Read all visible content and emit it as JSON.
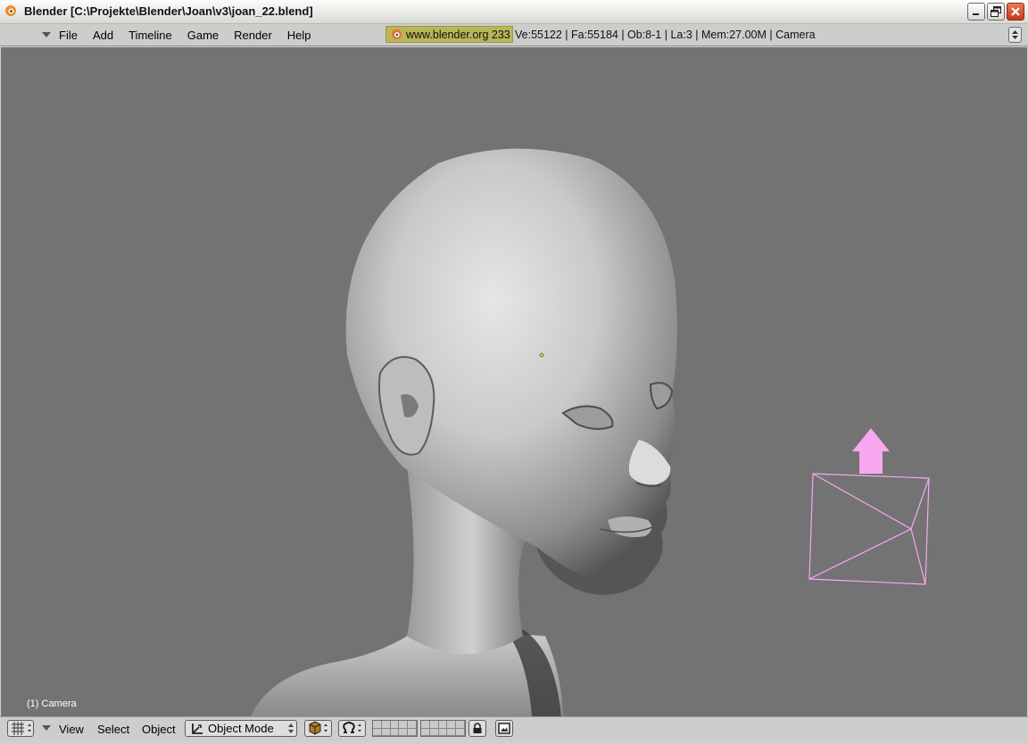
{
  "window": {
    "title": "Blender [C:\\Projekte\\Blender\\Joan\\v3\\joan_22.blend]"
  },
  "menubar": {
    "items": [
      "File",
      "Add",
      "Timeline",
      "Game",
      "Render",
      "Help"
    ]
  },
  "info": {
    "badge": "www.blender.org 233",
    "stats": "Ve:55122 | Fa:55184 | Ob:8-1 | La:3 | Mem:27.00M | Camera"
  },
  "viewport": {
    "object_label": "(1) Camera",
    "background_color": "#737373",
    "camera_wire_color": "#f7a8f0"
  },
  "bottom_header": {
    "menus": [
      "View",
      "Select",
      "Object"
    ],
    "mode": "Object Mode"
  },
  "icons": {
    "app": "blender-logo-icon",
    "minimize": "minimize-icon",
    "maximize": "restore-icon",
    "close": "close-icon",
    "editor_type": "grid-editor-icon",
    "draw_type": "shading-cube-icon",
    "pivot": "pivot-icon",
    "lock": "lock-icon",
    "render": "render-image-icon"
  }
}
